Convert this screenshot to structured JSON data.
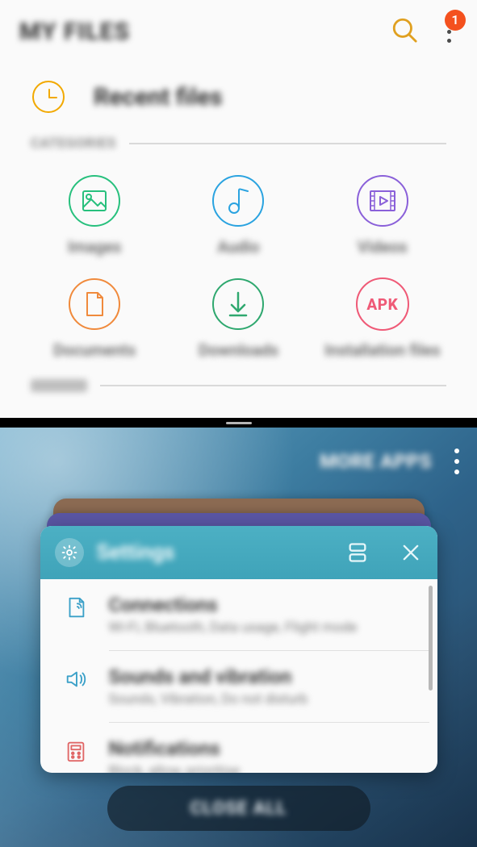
{
  "header": {
    "title": "MY FILES",
    "badge_count": "1"
  },
  "recent": {
    "title": "Recent files"
  },
  "sections": {
    "categories_label": "CATEGORIES"
  },
  "categories": [
    {
      "label": "Images"
    },
    {
      "label": "Audio"
    },
    {
      "label": "Videos"
    },
    {
      "label": "Documents"
    },
    {
      "label": "Downloads"
    },
    {
      "label": "Installation files",
      "apk_text": "APK"
    }
  ],
  "colors": {
    "images": "#27c07d",
    "audio": "#2aa3e0",
    "videos": "#8a60d9",
    "documents": "#f08a3c",
    "downloads": "#2fa86f",
    "apk": "#ef5a77",
    "accent_orange": "#f2a900",
    "badge": "#f4511e",
    "settings_header": "#43a8be"
  },
  "recents": {
    "more_apps": "MORE APPS",
    "close_all": "CLOSE ALL"
  },
  "settings_card": {
    "title": "Settings",
    "rows": [
      {
        "title": "Connections",
        "subtitle": "Wi-Fi, Bluetooth, Data usage, Flight mode"
      },
      {
        "title": "Sounds and vibration",
        "subtitle": "Sounds, Vibration, Do not disturb"
      },
      {
        "title": "Notifications",
        "subtitle": "Block, allow, prioritise"
      }
    ]
  }
}
